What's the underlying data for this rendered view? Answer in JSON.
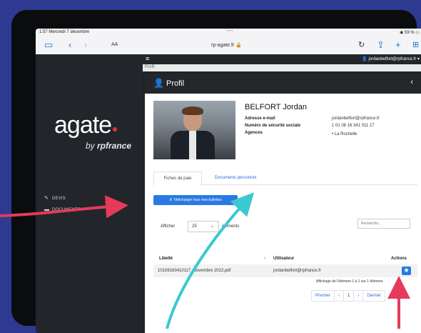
{
  "status": {
    "time": "1:57  Mercredi 7 décembre",
    "dots": "•••",
    "battery": "◉ 59 % ▭"
  },
  "browser": {
    "aa": "AA",
    "url": "rp-agate.fr 🔒"
  },
  "sidebar": {
    "logo": "agate",
    "logo_sub_prefix": "by ",
    "logo_sub_brand": "rpfrance",
    "items": [
      {
        "icon": "wrench-icon",
        "label": "DEVIS"
      },
      {
        "icon": "folder-icon",
        "label": "DOCUMENTS"
      }
    ]
  },
  "topbar": {
    "user": "👤 jordanbelfort@rpfrance.fr ▾"
  },
  "breadcrumb": "Profil",
  "profile": {
    "card_title": "Profil",
    "name": "BELFORT Jordan",
    "fields": [
      {
        "label": "Adresse e-mail",
        "value": "jordanbelfort@rpfrance.fr"
      },
      {
        "label": "Numéro de sécurité sociale",
        "value": "1 01 08 16 341 011 17"
      },
      {
        "label": "Agences",
        "value": "• La Rochelle"
      }
    ]
  },
  "tabs": [
    {
      "label": "Fiches de paie"
    },
    {
      "label": "Documents personnel"
    }
  ],
  "download_label": "⬇ Télécharger tous mes bulletins",
  "table_controls": {
    "show": "Afficher",
    "select_value": "25",
    "elements": "éléments",
    "search_placeholder": "Recherche..."
  },
  "table": {
    "headers": [
      "Libellé",
      "Utilisateur",
      "Actions"
    ],
    "rows": [
      {
        "label": "10108163410117_Novembre 2022.pdf",
        "user": "jordanbelfort@rpfrance.fr"
      }
    ]
  },
  "info": "Affichage de l'élément 1 à 1 sur 1 élément",
  "pager": [
    "Premier",
    "‹",
    "1",
    "›",
    "Dernier"
  ]
}
